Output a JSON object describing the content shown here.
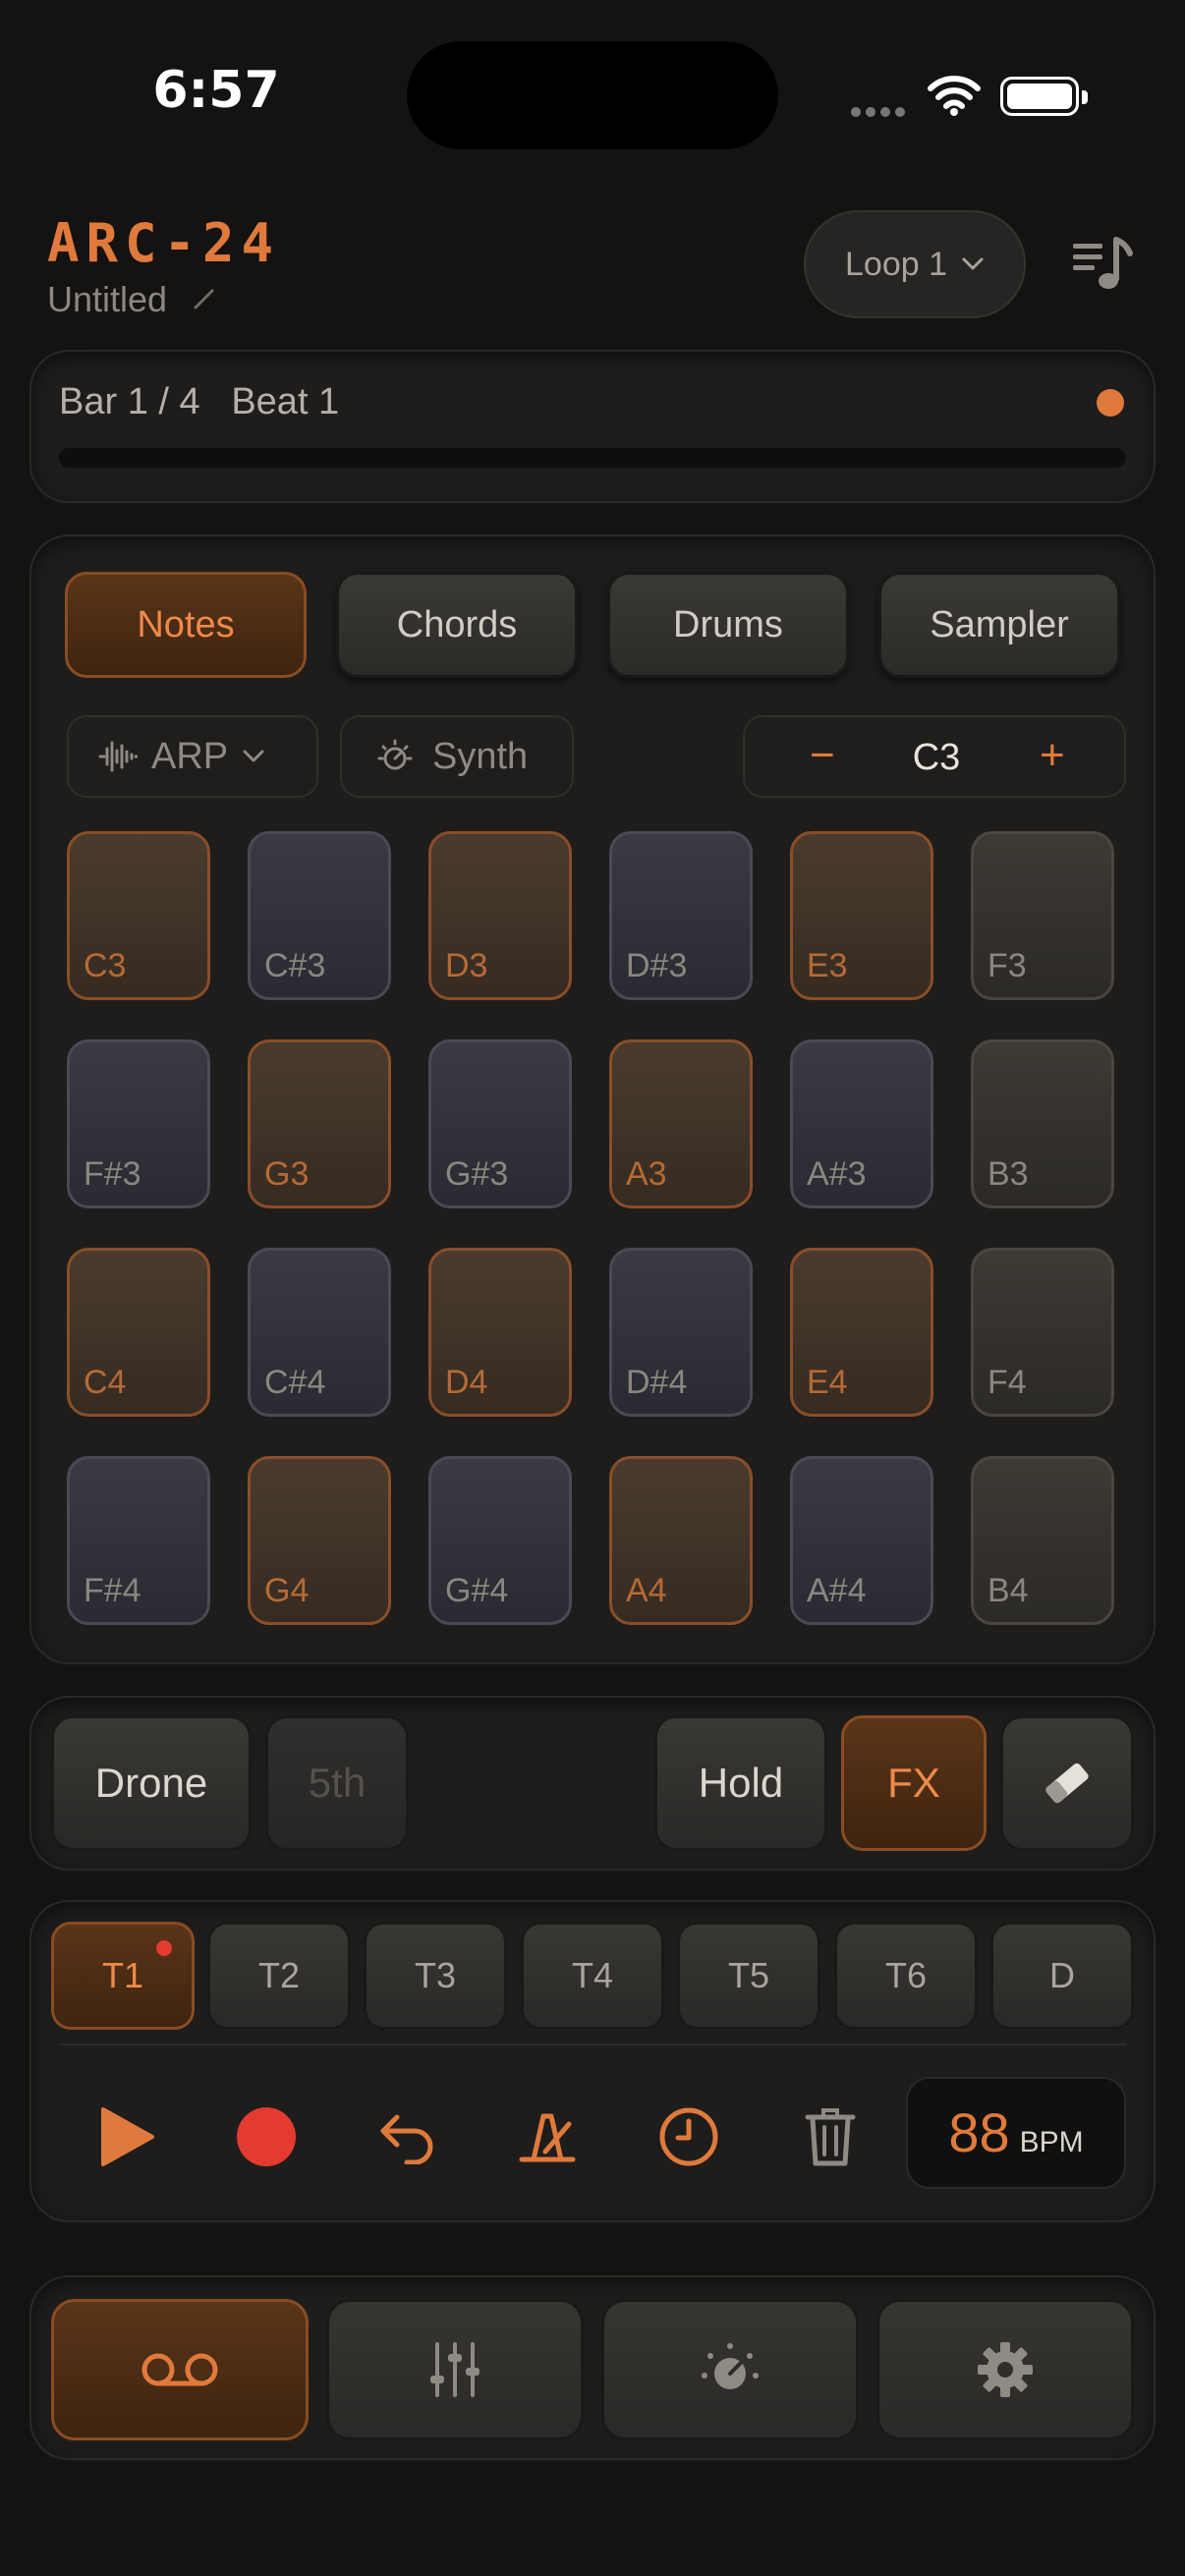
{
  "status": {
    "time": "6:57"
  },
  "header": {
    "app_title": "ARC-24",
    "project_name": "Untitled",
    "loop_label": "Loop 1"
  },
  "position": {
    "bar": "Bar 1 / 4",
    "beat": "Beat 1",
    "progress": 0.0
  },
  "modes": [
    {
      "label": "Notes",
      "active": true
    },
    {
      "label": "Chords",
      "active": false
    },
    {
      "label": "Drums",
      "active": false
    },
    {
      "label": "Sampler",
      "active": false
    }
  ],
  "controls": {
    "arp_label": "ARP",
    "synth_label": "Synth",
    "octave_value": "C3",
    "minus": "−",
    "plus": "+"
  },
  "pads": [
    [
      "C3",
      "C#3",
      "D3",
      "D#3",
      "E3",
      "F3"
    ],
    [
      "F#3",
      "G3",
      "G#3",
      "A3",
      "A#3",
      "B3"
    ],
    [
      "C4",
      "C#4",
      "D4",
      "D#4",
      "E4",
      "F4"
    ],
    [
      "F#4",
      "G4",
      "G#4",
      "A4",
      "A#4",
      "B4"
    ]
  ],
  "performance": {
    "drone": "Drone",
    "fifth": "5th",
    "hold": "Hold",
    "fx": "FX"
  },
  "tracks": [
    {
      "label": "T1",
      "active": true,
      "recording": true
    },
    {
      "label": "T2",
      "active": false
    },
    {
      "label": "T3",
      "active": false
    },
    {
      "label": "T4",
      "active": false
    },
    {
      "label": "T5",
      "active": false
    },
    {
      "label": "T6",
      "active": false
    },
    {
      "label": "D",
      "active": false
    }
  ],
  "transport": {
    "bpm_value": "88",
    "bpm_unit": "BPM"
  },
  "nav": {
    "active": "recorder",
    "items": [
      "recorder-icon",
      "mixer-icon",
      "knob-icon",
      "gear-icon"
    ]
  },
  "colors": {
    "accent": "#e07a3c",
    "record": "#e43b30",
    "background": "#141312"
  }
}
